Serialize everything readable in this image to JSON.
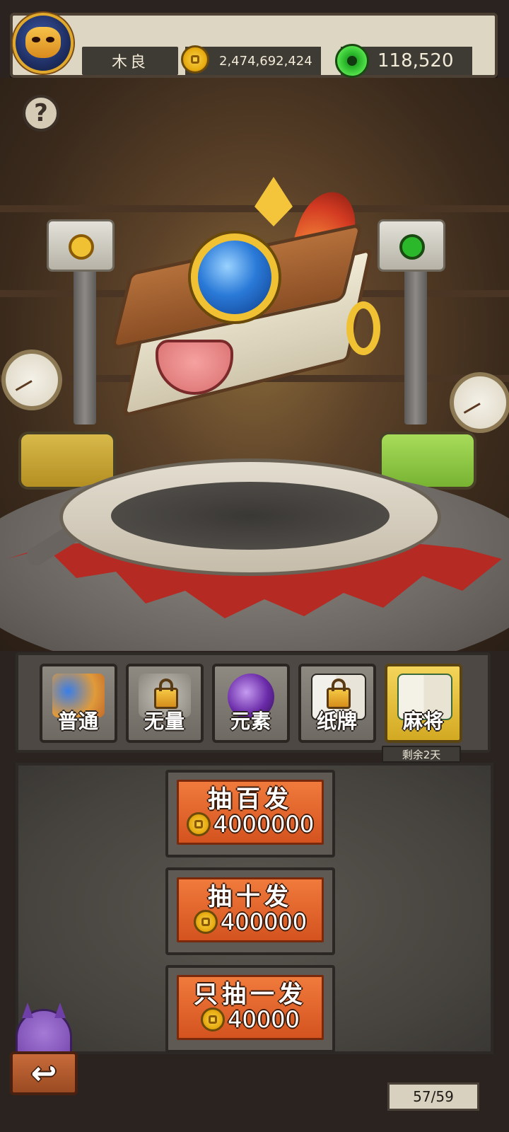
{
  "header": {
    "player_name": "木良",
    "gold": "2,474,692,424",
    "gems": "118,520"
  },
  "help": {
    "label": "?"
  },
  "tabs": [
    {
      "label": "普通",
      "active": false,
      "locked": false
    },
    {
      "label": "无量",
      "active": false,
      "locked": true
    },
    {
      "label": "元素",
      "active": false,
      "locked": false
    },
    {
      "label": "纸牌",
      "active": false,
      "locked": true
    },
    {
      "label": "麻将",
      "active": true,
      "locked": false
    }
  ],
  "remaining": "剩余2天",
  "draw_buttons": [
    {
      "title": "抽百发",
      "cost": "4000000"
    },
    {
      "title": "抽十发",
      "cost": "400000"
    },
    {
      "title": "只抽一发",
      "cost": "40000"
    }
  ],
  "back": {
    "glyph": "↩"
  },
  "page_count": "57/59",
  "colors": {
    "accent_gold": "#f0c233",
    "button_orange": "#e56a2c",
    "gem_green": "#2bb82b",
    "active_tab": "#f4d55a"
  },
  "icons": [
    "mask-avatar-icon",
    "gold-coin-icon",
    "green-gem-icon",
    "help-icon",
    "lock-icon",
    "back-arrow-icon"
  ]
}
